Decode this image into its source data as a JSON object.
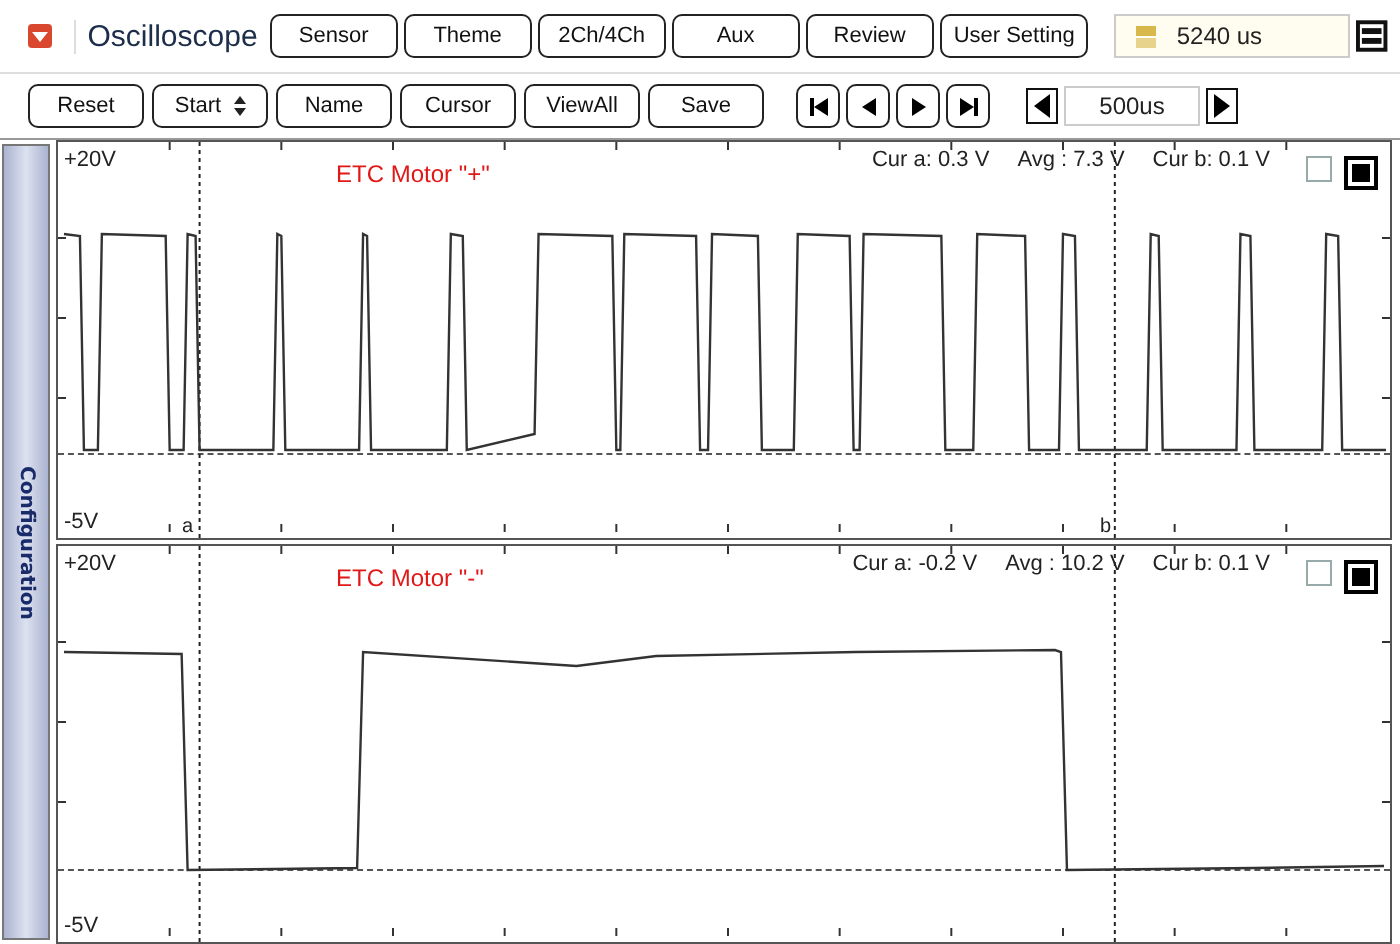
{
  "header": {
    "title": "Oscilloscope",
    "menu_buttons": [
      "Sensor",
      "Theme",
      "2Ch/4Ch",
      "Aux",
      "Review",
      "User Setting"
    ],
    "time_display": "5240 us"
  },
  "toolbar": {
    "buttons": [
      {
        "kind": "plain",
        "label": "Reset"
      },
      {
        "kind": "spinner",
        "label": "Start"
      },
      {
        "kind": "plain",
        "label": "Name"
      },
      {
        "kind": "plain",
        "label": "Cursor"
      },
      {
        "kind": "plain",
        "label": "ViewAll"
      },
      {
        "kind": "plain",
        "label": "Save"
      }
    ],
    "timebase": "500us"
  },
  "sidebar": {
    "tab": "Configuration"
  },
  "channels": [
    {
      "title": "ETC Motor \"+\"",
      "top_label": "+20V",
      "bottom_label": "-5V",
      "cur_a": "Cur a: 0.3 V",
      "avg": "Avg  : 7.3 V",
      "cur_b": "Cur b: 0.1 V",
      "cursor_labels": [
        "a",
        "b"
      ],
      "toggles": [
        {
          "checked": false
        },
        {
          "checked": true
        }
      ]
    },
    {
      "title": "ETC Motor \"-\"",
      "top_label": "+20V",
      "bottom_label": "-5V",
      "cur_a": "Cur a: -0.2 V",
      "avg": "Avg  : 10.2 V",
      "cur_b": "Cur b: 0.1 V",
      "toggles": [
        {
          "checked": false
        },
        {
          "checked": true
        }
      ]
    }
  ]
}
